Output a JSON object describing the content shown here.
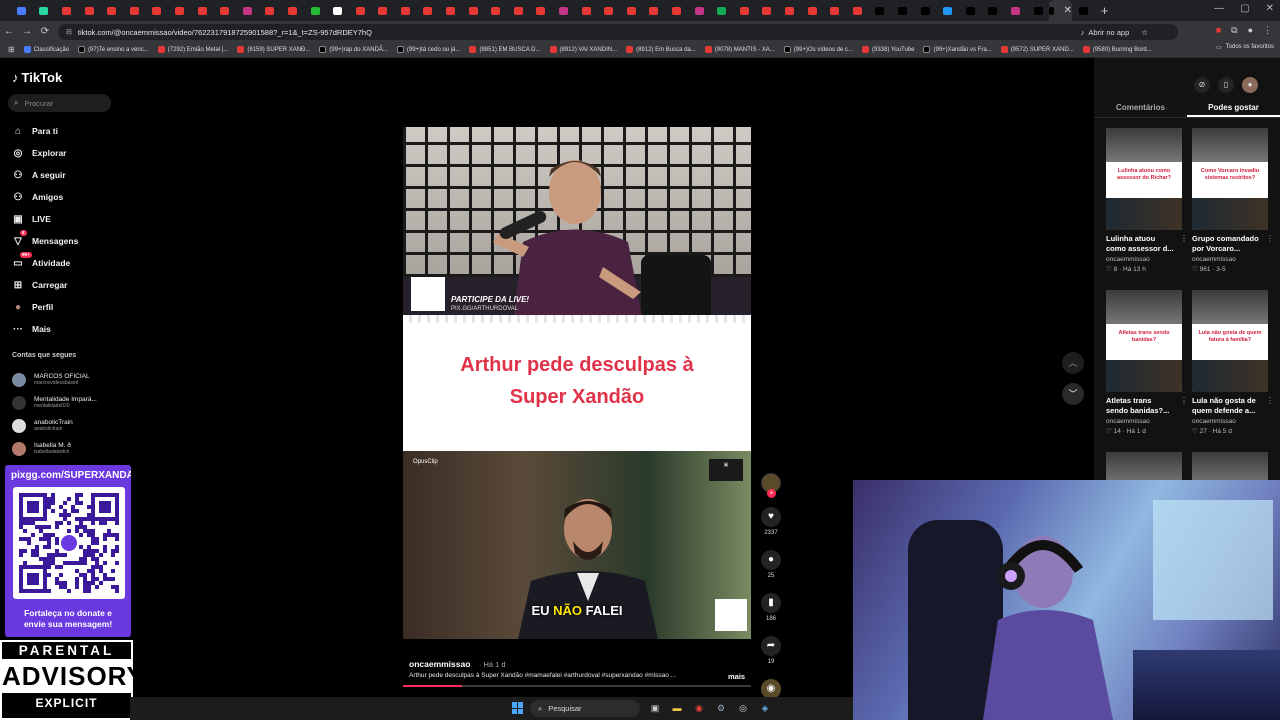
{
  "browser": {
    "url": "tiktok.com/@oncaemmissao/video/7622317918725901588?_r=1&_t=ZS-957dRDEY7hQ",
    "open_in_app": "Abrir no app",
    "tab_colors": [
      "#4a7cff",
      "#2bd4a0",
      "#e53935",
      "#e53935",
      "#e53935",
      "#e53935",
      "#e53935",
      "#e53935",
      "#e53935",
      "#e53935",
      "#c13584",
      "#e53935",
      "#e53935",
      "#22bb33",
      "#ffffff",
      "#e53935",
      "#e53935",
      "#e53935",
      "#e53935",
      "#e53935",
      "#e53935",
      "#e53935",
      "#e53935",
      "#e53935",
      "#c13584",
      "#e53935",
      "#e53935",
      "#e53935",
      "#e53935",
      "#e53935",
      "#c13584",
      "#11aa55",
      "#e53935",
      "#e53935",
      "#e53935",
      "#e53935",
      "#e53935",
      "#e53935",
      "#000000",
      "#000000",
      "#000000",
      "#2196f3",
      "#000000",
      "#000000",
      "#c13584",
      "#000000",
      "#000000",
      "#000000"
    ],
    "bookmarks": [
      {
        "label": "Classificação",
        "color": "#4a7cff"
      },
      {
        "label": "(97)Te ensino a venc...",
        "color": "#000000"
      },
      {
        "label": "(7292) Emião Metal |...",
        "color": "#e53935"
      },
      {
        "label": "(8159) SUPER XANÐ...",
        "color": "#e53935"
      },
      {
        "label": "(99+)rap do XANDÃ...",
        "color": "#000000"
      },
      {
        "label": "(99+)tá cedo ou já...",
        "color": "#000000"
      },
      {
        "label": "(8851) EM BUSCA D...",
        "color": "#e53935"
      },
      {
        "label": "(8912) VAI XANDIN...",
        "color": "#e53935"
      },
      {
        "label": "(8912) Em Busca da...",
        "color": "#e53935"
      },
      {
        "label": "(9078) MANTIS - XA...",
        "color": "#e53935"
      },
      {
        "label": "(99+)Os vídeos de c...",
        "color": "#000000"
      },
      {
        "label": "(9338) YouTube",
        "color": "#e53935"
      },
      {
        "label": "(99+)Xandão vs Fra...",
        "color": "#000000"
      },
      {
        "label": "(9572) SUPER XAND...",
        "color": "#e53935"
      },
      {
        "label": "(9580) Burning Bord...",
        "color": "#e53935"
      }
    ],
    "all_favorites": "Todos os favoritos"
  },
  "sidebar": {
    "logo": "TikTok",
    "search_placeholder": "Procurar",
    "nav": [
      {
        "icon": "home-icon",
        "label": "Para ti"
      },
      {
        "icon": "compass-icon",
        "label": "Explorar"
      },
      {
        "icon": "following-icon",
        "label": "A seguir"
      },
      {
        "icon": "friends-icon",
        "label": "Amigos"
      },
      {
        "icon": "live-icon",
        "label": "LIVE"
      },
      {
        "icon": "messages-icon",
        "label": "Mensagens",
        "badge": "8"
      },
      {
        "icon": "activity-icon",
        "label": "Atividade",
        "badge": "99+"
      },
      {
        "icon": "upload-icon",
        "label": "Carregar"
      },
      {
        "icon": "profile-icon",
        "label": "Perfil"
      },
      {
        "icon": "more-icon",
        "label": "Mais"
      }
    ],
    "following_title": "Contas que segues",
    "following": [
      {
        "name": "MARCOS OFICIAL",
        "handle": "marcosvideosbased",
        "color": "#7a8aa0"
      },
      {
        "name": "Mentalidade Impará...",
        "handle": "mentalidade020",
        "color": "#333333"
      },
      {
        "name": "anabolicTrain",
        "handle": "anabolictrain",
        "color": "#dddddd"
      },
      {
        "name": "Isabella M. ð",
        "handle": "isabelladatwitch",
        "color": "#b07a6a"
      }
    ]
  },
  "overlay": {
    "qr_title": "pixgg.com/SUPERXANDÃO",
    "qr_subtitle_1": "Fortaleça no donate e",
    "qr_subtitle_2": "envie sua mensagem!",
    "advisory_1": "PARENTAL",
    "advisory_2": "ADVISORY",
    "advisory_3": "EXPLICIT CONTENT"
  },
  "video": {
    "live_text": "PARTICIPE DA LIVE!",
    "live_sub": "PIX.GG/ARTHURDOVAL",
    "headline_1": "Arthur pede desculpas à",
    "headline_2": "Super Xandão",
    "subtitle_a": "EU",
    "subtitle_b": "NÃO",
    "subtitle_c": "FALEI",
    "watermark": "OpusClip",
    "author": "oncaemmissao",
    "date": "Há 1 d",
    "description": "Arthur pede desculpas à Super Xandão #mamaefalei #arthurdoval #superxandao #missao ...",
    "more": "mais",
    "progress": 0.17
  },
  "actions": {
    "likes": "2337",
    "comments": "25",
    "saves": "186",
    "shares": "19"
  },
  "right_panel": {
    "tabs": [
      "Comentários",
      "Podes gostar"
    ],
    "active_tab": 1,
    "cards": [
      {
        "thumb_text": "Lulinha atuou como assessor do Richar?",
        "title_1": "Lulinha atuou",
        "title_2": "como assessor d...",
        "author": "oncaemmissao",
        "likes": "8",
        "date": "Há 13 h"
      },
      {
        "thumb_text": "Como Vorcaro invadiu sistemas restritos?",
        "title_1": "Grupo comandado",
        "title_2": "por Vorcaro...",
        "author": "oncaemmissao",
        "likes": "961",
        "date": "3-5"
      },
      {
        "thumb_text": "Atletas trans sendo banidas?",
        "title_1": "Atletas trans",
        "title_2": "sendo banidas?...",
        "author": "oncaemmissao",
        "likes": "14",
        "date": "Há 1 d"
      },
      {
        "thumb_text": "Lula não gosta de quem fatura à família?",
        "title_1": "Lula não gosta de",
        "title_2": "quem defende a...",
        "author": "oncaemmissao",
        "likes": "27",
        "date": "Há 5 d"
      }
    ]
  },
  "taskbar": {
    "search": "Pesquisar"
  }
}
